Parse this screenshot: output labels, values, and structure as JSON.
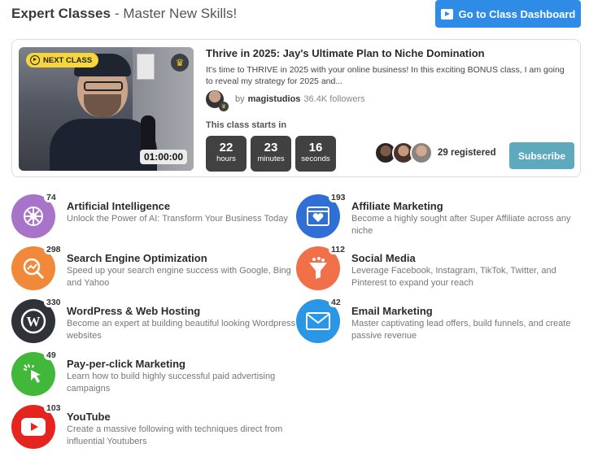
{
  "header": {
    "title": "Expert Classes",
    "subtitle": "- Master New Skills!",
    "dashboard_button": "Go to Class Dashboard"
  },
  "next_class": {
    "badge": "NEXT CLASS",
    "duration": "01:00:00",
    "title": "Thrive in 2025: Jay's Ultimate Plan to Niche Domination",
    "description": "It's time to THRIVE in 2025 with your online business! In this exciting BONUS class, I am going to reveal my strategy for 2025 and...",
    "by_label": "by",
    "author": "magistudios",
    "followers": "36.4K followers",
    "starts_label": "This class starts in",
    "countdown": [
      {
        "value": "22",
        "unit": "hours"
      },
      {
        "value": "23",
        "unit": "minutes"
      },
      {
        "value": "16",
        "unit": "seconds"
      }
    ],
    "registered": "29 registered",
    "subscribe_label": "Subscribe"
  },
  "categories": [
    {
      "name": "Artificial Intelligence",
      "count": "74",
      "description": "Unlock the Power of AI: Transform Your Business Today",
      "icon": "brain-icon",
      "color": "#a874c9"
    },
    {
      "name": "Affiliate Marketing",
      "count": "193",
      "description": "Become a highly sought after Super Affiliate across any niche",
      "icon": "browser-heart-icon",
      "color": "#2f6fd6"
    },
    {
      "name": "Search Engine Optimization",
      "count": "298",
      "description": "Speed up your search engine success with Google, Bing and Yahoo",
      "icon": "magnifier-chart-icon",
      "color": "#f08a3a"
    },
    {
      "name": "Social Media",
      "count": "112",
      "description": "Leverage Facebook, Instagram, TikTok, Twitter, and Pinterest to expand your reach",
      "icon": "funnel-icon",
      "color": "#f0704a"
    },
    {
      "name": "WordPress & Web Hosting",
      "count": "330",
      "description": "Become an expert at building beautiful looking Wordpress websites",
      "icon": "wordpress-icon",
      "color": "#2f3338"
    },
    {
      "name": "Email Marketing",
      "count": "42",
      "description": "Master captivating lead offers, build funnels, and create passive revenue",
      "icon": "envelope-icon",
      "color": "#2a96e6"
    },
    {
      "name": "Pay-per-click Marketing",
      "count": "49",
      "description": "Learn how to build highly successful paid advertising campaigns",
      "icon": "cursor-click-icon",
      "color": "#41b83a"
    },
    {
      "name": "YouTube",
      "count": "103",
      "description": "Create a massive following with techniques direct from influential Youtubers",
      "icon": "youtube-icon",
      "color": "#e52420"
    }
  ]
}
